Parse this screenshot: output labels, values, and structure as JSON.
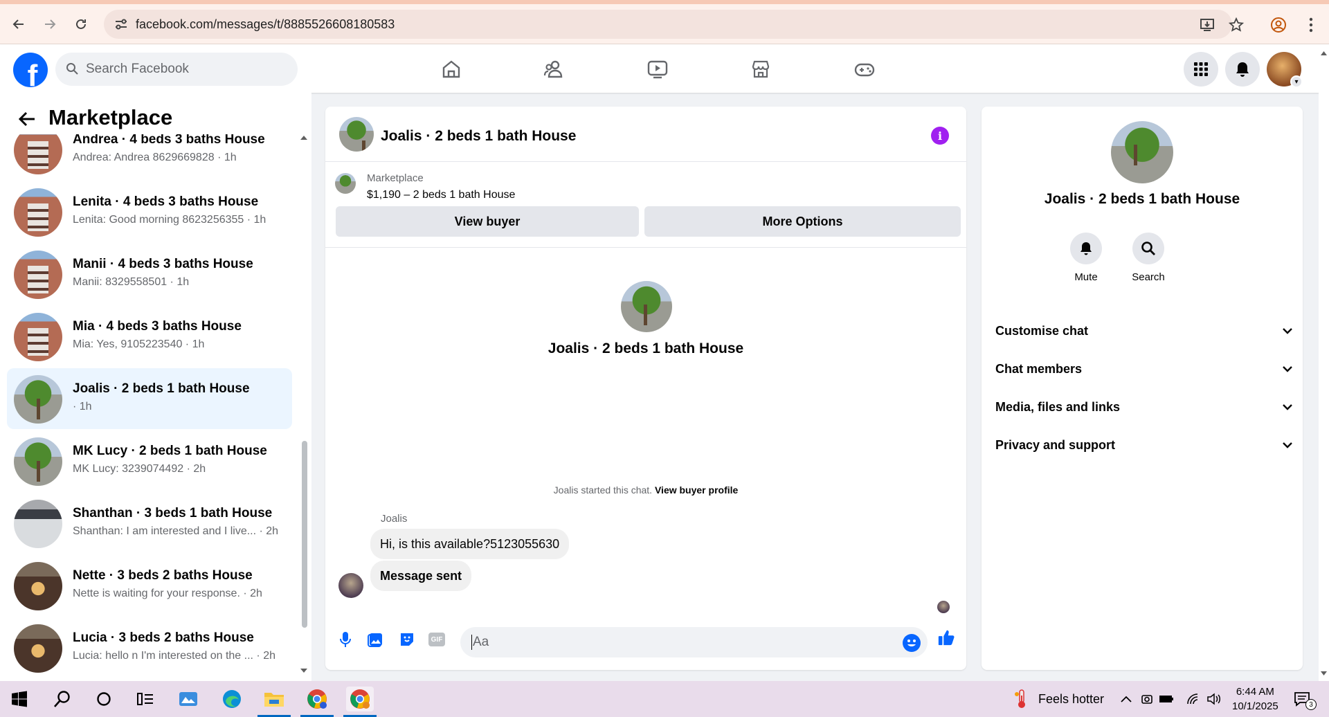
{
  "browser": {
    "url": "facebook.com/messages/t/8885526608180583"
  },
  "fb_header": {
    "logo": "f",
    "search_placeholder": "Search Facebook",
    "nav_icons": [
      "home-icon",
      "friends-icon",
      "watch-icon",
      "marketplace-icon",
      "gaming-icon"
    ],
    "brand_color": "#0866ff"
  },
  "sidebar": {
    "title": "Marketplace",
    "conversations": [
      {
        "name": "Andrea · 4 beds 3 baths House",
        "sub": "Andrea: Andrea 8629669828 · 1h",
        "thumb": "house1"
      },
      {
        "name": "Lenita · 4 beds 3 baths House",
        "sub": "Lenita: Good morning 8623256355 · 1h",
        "thumb": "house1"
      },
      {
        "name": "Manii · 4 beds 3 baths House",
        "sub": "Manii: 8329558501 · 1h",
        "thumb": "house1"
      },
      {
        "name": "Mia · 4 beds 3 baths House",
        "sub": "Mia: Yes, 9105223540 · 1h",
        "thumb": "house1"
      },
      {
        "name": "Joalis · 2 beds 1 bath House",
        "sub": " · 1h",
        "thumb": "tree",
        "active": true
      },
      {
        "name": "MK Lucy · 2 beds 1 bath House",
        "sub": "MK Lucy: 3239074492 · 2h",
        "thumb": "tree"
      },
      {
        "name": "Shanthan · 3 beds 1 bath House",
        "sub": "Shanthan: I am interested and I live... · 2h",
        "thumb": "house2"
      },
      {
        "name": "Nette · 3 beds 2 baths House",
        "sub": "Nette is waiting for your response. · 2h",
        "thumb": "house3"
      },
      {
        "name": "Lucia · 3 beds 2 baths House",
        "sub": "Lucia: hello n I'm interested on the ... · 2h",
        "thumb": "house3"
      }
    ]
  },
  "chat": {
    "title": "Joalis · 2 beds 1 bath House",
    "marketplace_label": "Marketplace",
    "price_line": "$1,190 – 2 beds 1 bath House",
    "view_buyer": "View buyer",
    "more_options": "More Options",
    "center_name": "Joalis · 2 beds 1 bath House",
    "started_text": "Joalis started this chat.",
    "view_profile": "View buyer profile",
    "sender": "Joalis",
    "messages": [
      "Hi, is this available?5123055630",
      "Message sent"
    ],
    "input_placeholder": "Aa",
    "gif_label": "GIF"
  },
  "details": {
    "name": "Joalis · 2 beds 1 bath House",
    "mute": "Mute",
    "search": "Search",
    "sections": [
      "Customise chat",
      "Chat members",
      "Media, files and links",
      "Privacy and support"
    ]
  },
  "taskbar": {
    "weather": "Feels hotter",
    "time": "6:44 AM",
    "date": "10/1/2025",
    "notification_count": "3"
  }
}
